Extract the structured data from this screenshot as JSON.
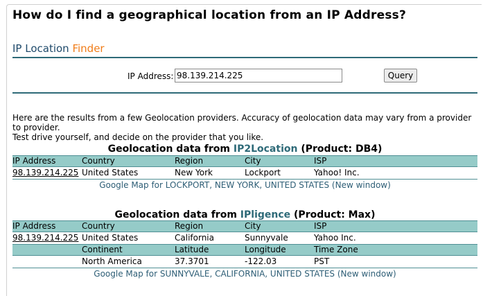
{
  "page": {
    "title": "How do I find a geographical location from an IP Address?"
  },
  "finder": {
    "title_main": "IP Location",
    "title_accent": "Finder",
    "ip_label": "IP Address:",
    "ip_value": "98.139.214.225",
    "query_label": "Query"
  },
  "intro": {
    "line1": "Here are the results from a few Geolocation providers. Accuracy of geolocation data may vary from a provider to provider.",
    "line2": "Test drive yourself, and decide on the provider that you like."
  },
  "section1": {
    "prefix": "Geolocation data from",
    "provider": "IP2Location",
    "product": "(Product: DB4)",
    "headers": [
      "IP Address",
      "Country",
      "Region",
      "City",
      "ISP"
    ],
    "row": [
      "98.139.214.225",
      "United States",
      "New York",
      "Lockport",
      "Yahoo! Inc."
    ],
    "map_link": "Google Map for LOCKPORT, NEW YORK, UNITED STATES (New window)"
  },
  "section2": {
    "prefix": "Geolocation data from",
    "provider": "IPligence",
    "product": "(Product: Max)",
    "headers": [
      "IP Address",
      "Country",
      "Region",
      "City",
      "ISP"
    ],
    "row": [
      "98.139.214.225",
      "United States",
      "California",
      "Sunnyvale",
      "Yahoo Inc."
    ],
    "headers2": [
      "",
      "Continent",
      "Latitude",
      "Longitude",
      "Time Zone"
    ],
    "row2": [
      "",
      "North America",
      "37.3701",
      "-122.03",
      "PST"
    ],
    "map_link": "Google Map for SUNNYVALE, CALIFORNIA, UNITED STATES (New window)"
  },
  "colors": {
    "accent": "#f07d1a",
    "header_bg": "#95cbc8",
    "rule": "#2e6a78",
    "link": "#2e5e76"
  }
}
